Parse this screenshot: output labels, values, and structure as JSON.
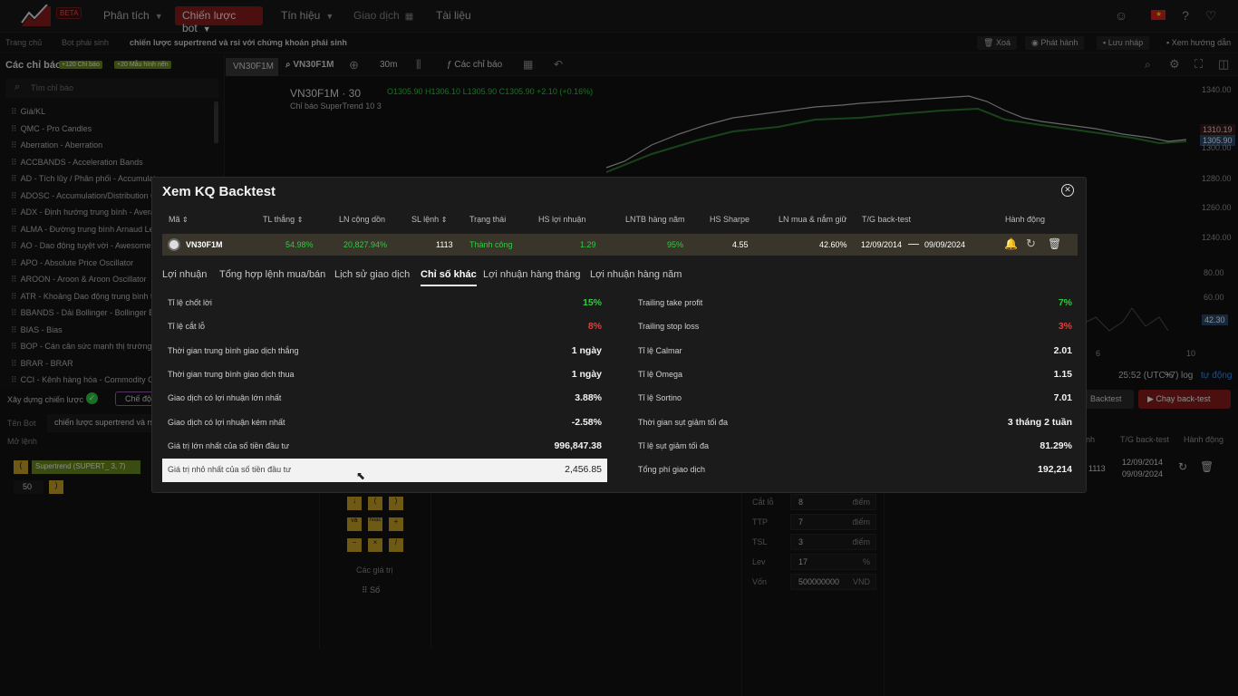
{
  "nav": {
    "beta": "BETA",
    "phan_tich": "Phân tích",
    "chien_luoc_bot": "Chiến lược bot",
    "tin_hieu": "Tín hiệu",
    "giao_dich": "Giao dịch",
    "tai_lieu": "Tài liệu"
  },
  "breadcrumb": {
    "home": "Trang chủ",
    "bot": "Bot phái sinh",
    "current": "chiến lược supertrend và rsi với chứng khoán phái sinh"
  },
  "actions": {
    "delete": "Xoá",
    "publish": "Phát hành",
    "save_draft": "Lưu nháp",
    "guide": "Xem hướng dẫn"
  },
  "left": {
    "title": "Các chỉ báo",
    "badge1": "+120 Chỉ báo",
    "badge2": "+20 Mẫu hình nến",
    "search_placeholder": "Tìm chỉ báo",
    "items": [
      "Giá/KL",
      "QMC - Pro Candles",
      "Aberration - Aberration",
      "ACCBANDS - Acceleration Bands",
      "AD - Tích lũy / Phân phối - Accumulat",
      "ADOSC - Accumulation/Distribution O",
      "ADX - Định hướng trung bình - Avera",
      "ALMA - Đường trung bình Arnaud Leg",
      "AO - Dao động tuyệt vời - Awesome O",
      "APO - Absolute Price Oscillator",
      "AROON - Aroon & Aroon Oscillator",
      "ATR - Khoảng Dao động trung bình th",
      "BBANDS - Dải Bollinger - Bollinger Ba",
      "BIAS - Bias",
      "BOP - Cán cân sức mạnh thị trường -",
      "BRAR - BRAR",
      "CCI - Kênh hàng hóa - Commodity Ch"
    ]
  },
  "chart": {
    "symbol_btn": "VN30F1M",
    "symbol": "VN30F1M",
    "interval": "30m",
    "indicators": "Các chỉ báo",
    "header": "VN30F1M · 30",
    "ohlc": "O1305.90 H1306.10 L1305.90 C1305.90 +2.10 (+0.16%)",
    "supertrend": "Chỉ báo SuperTrend 10 3",
    "prices": [
      "1340.00",
      "1310.19",
      "1305.90",
      "1300.00",
      "1280.00",
      "1260.00",
      "1240.00",
      "80.00",
      "60.00",
      "42.30"
    ],
    "time": "25:52 (UTC+7)",
    "pct": "%",
    "log": "log",
    "auto": "tự động",
    "xticks": [
      "6",
      "10"
    ]
  },
  "bottom": {
    "build": "Xây dựng chiến lược",
    "mode": "Chế độ",
    "bot_name_label": "Tên Bot",
    "bot_name": "chiến lược supertrend và rsi",
    "open_label": "Mở lệnh",
    "st_token": "Supertrend (SUPERT_ 3, 7)",
    "num": "50",
    "backtest": "Backtest",
    "run": "Chạy back-test",
    "col_th": "nh",
    "col_tg": "T/G back-test",
    "col_hd": "Hành động",
    "r_count": "1113",
    "r_d1": "12/09/2014",
    "r_d2": "09/09/2024",
    "values_label": "Các giá trị",
    "so": "Số",
    "params": [
      {
        "label": "Cắt lỗ",
        "value": "8",
        "unit": "điểm"
      },
      {
        "label": "TTP",
        "value": "7",
        "unit": "điểm"
      },
      {
        "label": "TSL",
        "value": "3",
        "unit": "điểm"
      },
      {
        "label": "Lev",
        "value": "17",
        "unit": "%"
      },
      {
        "label": "Vốn",
        "value": "500000000",
        "unit": "VND"
      }
    ]
  },
  "modal": {
    "title": "Xem KQ Backtest",
    "headers": [
      "Mã",
      "TL thắng",
      "LN cộng dồn",
      "SL lệnh",
      "Trạng thái",
      "HS lợi nhuận",
      "LNTB hàng năm",
      "HS Sharpe",
      "LN mua & nắm giữ",
      "T/G back-test",
      "Hành động"
    ],
    "row": {
      "code": "VN30F1M",
      "win_rate": "54.98%",
      "cum_profit": "20,827.94%",
      "orders": "1113",
      "status": "Thành công",
      "profit_factor": "1.29",
      "annual": "95%",
      "sharpe": "4.55",
      "buy_hold": "42.60%",
      "from": "12/09/2014",
      "to": "09/09/2024"
    },
    "tabs": [
      "Lợi nhuận",
      "Tổng hợp lệnh mua/bán",
      "Lịch sử giao dịch",
      "Chỉ số khác",
      "Lợi nhuận hàng tháng",
      "Lợi nhuận hàng năm"
    ],
    "left_stats": [
      {
        "label": "Tỉ lệ chốt lời",
        "value": "15%"
      },
      {
        "label": "Tỉ lệ cắt lỗ",
        "value": "8%"
      },
      {
        "label": "Thời gian trung bình giao dịch thắng",
        "value": "1 ngày"
      },
      {
        "label": "Thời gian trung bình giao dịch thua",
        "value": "1 ngày"
      },
      {
        "label": "Giao dịch có lợi nhuận lớn nhất",
        "value": "3.88%"
      },
      {
        "label": "Giao dịch có lợi nhuận kém nhất",
        "value": "-2.58%"
      },
      {
        "label": "Giá trị lớn nhất của số tiền đầu tư",
        "value": "996,847.38"
      },
      {
        "label": "Giá trị nhỏ nhất của số tiền đầu tư",
        "value": "2,456.85"
      }
    ],
    "right_stats": [
      {
        "label": "Trailing take profit",
        "value": "7%"
      },
      {
        "label": "Trailing stop loss",
        "value": "3%"
      },
      {
        "label": "Tỉ lệ Calmar",
        "value": "2.01"
      },
      {
        "label": "Tỉ lệ Omega",
        "value": "1.15"
      },
      {
        "label": "Tỉ lệ Sortino",
        "value": "7.01"
      },
      {
        "label": "Thời gian sụt giảm tối đa",
        "value": "3 tháng 2 tuần"
      },
      {
        "label": "Tỉ lệ sụt giảm tối đa",
        "value": "81.29%"
      },
      {
        "label": "Tổng phí giao dịch",
        "value": "192,214"
      }
    ],
    "colors": {
      "green": "#2ecc40",
      "red": "#e23d3d",
      "accent": "#8b1c1c"
    }
  }
}
